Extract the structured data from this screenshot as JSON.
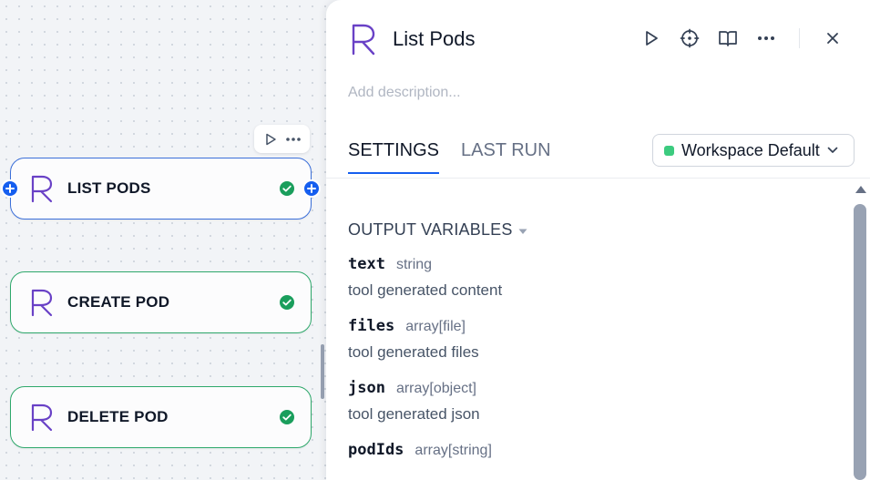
{
  "canvas": {
    "nodes": [
      {
        "title": "LIST PODS",
        "status": "success",
        "selected": true
      },
      {
        "title": "CREATE POD",
        "status": "success",
        "selected": false
      },
      {
        "title": "DELETE POD",
        "status": "success",
        "selected": false
      }
    ],
    "toolbar": {
      "run_icon": "play-icon",
      "more_icon": "more-horizontal-icon"
    }
  },
  "panel": {
    "title": "List Pods",
    "description_placeholder": "Add description...",
    "tabs": [
      {
        "label": "SETTINGS",
        "active": true
      },
      {
        "label": "LAST RUN",
        "active": false
      }
    ],
    "workspace_select": {
      "label": "Workspace Default",
      "dot_color": "#3ccb7f"
    },
    "output_section": {
      "title": "OUTPUT VARIABLES",
      "variables": [
        {
          "name": "text",
          "type": "string",
          "description": "tool generated content"
        },
        {
          "name": "files",
          "type": "array[file]",
          "description": "tool generated files"
        },
        {
          "name": "json",
          "type": "array[object]",
          "description": "tool generated json"
        },
        {
          "name": "podIds",
          "type": "array[string]",
          "description": ""
        }
      ]
    }
  },
  "colors": {
    "accent": "#155eef",
    "success": "#2ea86b",
    "logo": "#6941c6"
  }
}
